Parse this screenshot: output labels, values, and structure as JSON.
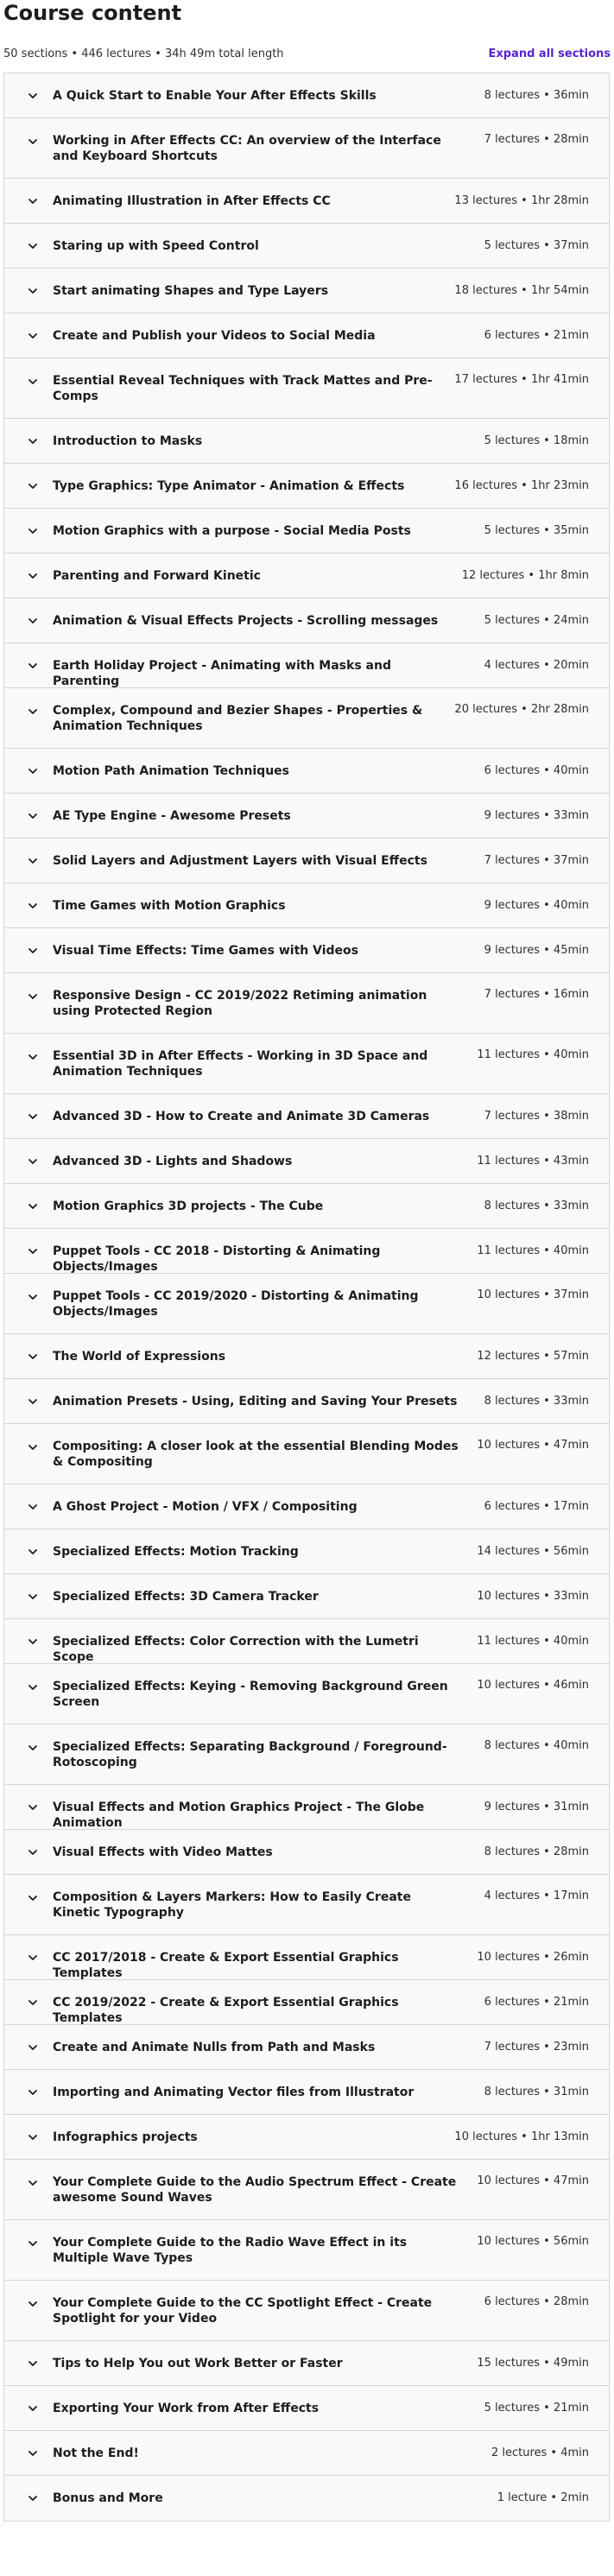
{
  "header": {
    "title": "Course content",
    "summary": "50 sections • 446 lectures • 34h 49m total length",
    "expand_label": "Expand all sections"
  },
  "colors": {
    "accent": "#5624d0",
    "row_background": "#f7f9fa",
    "border": "#d1d7dc",
    "text": "#1c1d1f"
  },
  "icons": {
    "section_toggle": "chevron-down-icon"
  },
  "sections": [
    {
      "title": "A Quick Start to Enable Your After Effects Skills",
      "meta": "8 lectures • 36min"
    },
    {
      "title": "Working in After Effects CC: An overview of the Interface and Keyboard Shortcuts",
      "meta": "7 lectures • 28min"
    },
    {
      "title": "Animating Illustration in After Effects CC",
      "meta": "13 lectures • 1hr 28min"
    },
    {
      "title": "Staring up with Speed Control",
      "meta": "5 lectures • 37min"
    },
    {
      "title": "Start animating Shapes and Type Layers",
      "meta": "18 lectures • 1hr 54min"
    },
    {
      "title": "Create and Publish your Videos to Social Media",
      "meta": "6 lectures • 21min"
    },
    {
      "title": "Essential Reveal Techniques with Track Mattes and Pre-Comps",
      "meta": "17 lectures • 1hr 41min"
    },
    {
      "title": "Introduction to Masks",
      "meta": "5 lectures • 18min"
    },
    {
      "title": "Type Graphics: Type Animator - Animation & Effects",
      "meta": "16 lectures • 1hr 23min"
    },
    {
      "title": "Motion Graphics with a purpose - Social Media Posts",
      "meta": "5 lectures • 35min"
    },
    {
      "title": "Parenting and Forward Kinetic",
      "meta": "12 lectures • 1hr 8min"
    },
    {
      "title": "Animation & Visual Effects Projects - Scrolling messages",
      "meta": "5 lectures • 24min"
    },
    {
      "title": "Earth Holiday Project - Animating with Masks and Parenting",
      "meta": "4 lectures • 20min"
    },
    {
      "title": "Complex, Compound and Bezier Shapes - Properties & Animation Techniques",
      "meta": "20 lectures • 2hr 28min"
    },
    {
      "title": "Motion Path Animation Techniques",
      "meta": "6 lectures • 40min"
    },
    {
      "title": "AE Type Engine - Awesome Presets",
      "meta": "9 lectures • 33min"
    },
    {
      "title": "Solid Layers and Adjustment Layers with Visual Effects",
      "meta": "7 lectures • 37min"
    },
    {
      "title": "Time Games with Motion Graphics",
      "meta": "9 lectures • 40min"
    },
    {
      "title": "Visual Time Effects: Time Games with Videos",
      "meta": "9 lectures • 45min"
    },
    {
      "title": "Responsive Design - CC 2019/2022 Retiming animation using Protected Region",
      "meta": "7 lectures • 16min"
    },
    {
      "title": "Essential 3D in After Effects - Working in 3D Space and Animation Techniques",
      "meta": "11 lectures • 40min"
    },
    {
      "title": "Advanced 3D - How to Create and Animate 3D Cameras",
      "meta": "7 lectures • 38min"
    },
    {
      "title": "Advanced 3D - Lights and Shadows",
      "meta": "11 lectures • 43min"
    },
    {
      "title": "Motion Graphics 3D projects - The Cube",
      "meta": "8 lectures • 33min"
    },
    {
      "title": "Puppet Tools - CC 2018 - Distorting & Animating Objects/Images",
      "meta": "11 lectures • 40min"
    },
    {
      "title": "Puppet Tools - CC 2019/2020 - Distorting & Animating Objects/Images",
      "meta": "10 lectures • 37min"
    },
    {
      "title": "The World of Expressions",
      "meta": "12 lectures • 57min"
    },
    {
      "title": "Animation Presets - Using, Editing and Saving Your Presets",
      "meta": "8 lectures • 33min"
    },
    {
      "title": "Compositing: A closer look at the essential Blending Modes & Compositing",
      "meta": "10 lectures • 47min"
    },
    {
      "title": "A Ghost Project - Motion / VFX / Compositing",
      "meta": "6 lectures • 17min"
    },
    {
      "title": "Specialized Effects: Motion Tracking",
      "meta": "14 lectures • 56min"
    },
    {
      "title": "Specialized Effects: 3D Camera Tracker",
      "meta": "10 lectures • 33min"
    },
    {
      "title": "Specialized Effects: Color Correction with the Lumetri Scope",
      "meta": "11 lectures • 40min"
    },
    {
      "title": "Specialized Effects: Keying - Removing Background Green Screen",
      "meta": "10 lectures • 46min"
    },
    {
      "title": "Specialized Effects: Separating Background / Foreground- Rotoscoping",
      "meta": "8 lectures • 40min"
    },
    {
      "title": "Visual Effects and Motion Graphics Project - The Globe Animation",
      "meta": "9 lectures • 31min"
    },
    {
      "title": "Visual Effects with Video Mattes",
      "meta": "8 lectures • 28min"
    },
    {
      "title": "Composition & Layers Markers: How to Easily Create Kinetic Typography",
      "meta": "4 lectures • 17min"
    },
    {
      "title": "CC 2017/2018 - Create & Export Essential Graphics Templates",
      "meta": "10 lectures • 26min"
    },
    {
      "title": "CC 2019/2022 - Create & Export Essential Graphics Templates",
      "meta": "6 lectures • 21min"
    },
    {
      "title": "Create and Animate Nulls from Path and Masks",
      "meta": "7 lectures • 23min"
    },
    {
      "title": "Importing and Animating Vector files from Illustrator",
      "meta": "8 lectures • 31min"
    },
    {
      "title": "Infographics projects",
      "meta": "10 lectures • 1hr 13min"
    },
    {
      "title": "Your Complete Guide to the Audio Spectrum Effect - Create awesome Sound Waves",
      "meta": "10 lectures • 47min"
    },
    {
      "title": "Your Complete Guide to the Radio Wave Effect in its Multiple Wave Types",
      "meta": "10 lectures • 56min"
    },
    {
      "title": "Your Complete Guide to the CC Spotlight Effect - Create Spotlight for your Video",
      "meta": "6 lectures • 28min"
    },
    {
      "title": "Tips to Help You out Work Better or Faster",
      "meta": "15 lectures • 49min"
    },
    {
      "title": "Exporting Your Work from After Effects",
      "meta": "5 lectures • 21min"
    },
    {
      "title": "Not the End!",
      "meta": "2 lectures • 4min"
    },
    {
      "title": "Bonus and More",
      "meta": "1 lecture • 2min"
    }
  ]
}
